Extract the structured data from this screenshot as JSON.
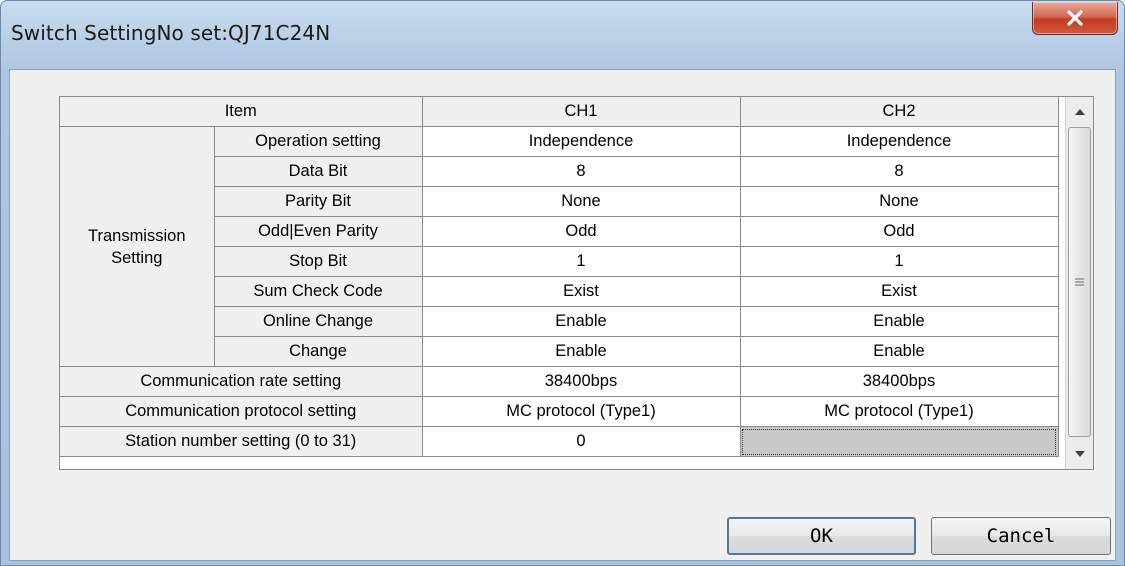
{
  "window": {
    "title": "Switch SettingNo set:QJ71C24N",
    "close_icon": "close-x-icon"
  },
  "grid": {
    "header": {
      "item": "Item",
      "ch1": "CH1",
      "ch2": "CH2"
    },
    "group_label_line1": "Transmission",
    "group_label_line2": "Setting",
    "transmission_rows": [
      {
        "label": "Operation setting",
        "ch1": "Independence",
        "ch2": "Independence"
      },
      {
        "label": "Data Bit",
        "ch1": "8",
        "ch2": "8"
      },
      {
        "label": "Parity Bit",
        "ch1": "None",
        "ch2": "None"
      },
      {
        "label": "Odd|Even Parity",
        "ch1": "Odd",
        "ch2": "Odd"
      },
      {
        "label": "Stop Bit",
        "ch1": "1",
        "ch2": "1"
      },
      {
        "label": "Sum Check Code",
        "ch1": "Exist",
        "ch2": "Exist"
      },
      {
        "label": "Online Change",
        "ch1": "Enable",
        "ch2": "Enable"
      },
      {
        "label": "Change",
        "ch1": "Enable",
        "ch2": "Enable"
      }
    ],
    "other_rows": [
      {
        "label": "Communication rate setting",
        "ch1": "38400bps",
        "ch2": "38400bps"
      },
      {
        "label": "Communication protocol setting",
        "ch1": "MC protocol (Type1)",
        "ch2": "MC protocol (Type1)"
      },
      {
        "label": "Station number setting (0 to 31)",
        "ch1": "0",
        "ch2": ""
      }
    ]
  },
  "scrollbar": {
    "up_icon": "scroll-up-arrow-icon",
    "down_icon": "scroll-down-arrow-icon",
    "thumb_grip_icon": "grip-icon"
  },
  "buttons": {
    "ok": "OK",
    "cancel": "Cancel"
  }
}
